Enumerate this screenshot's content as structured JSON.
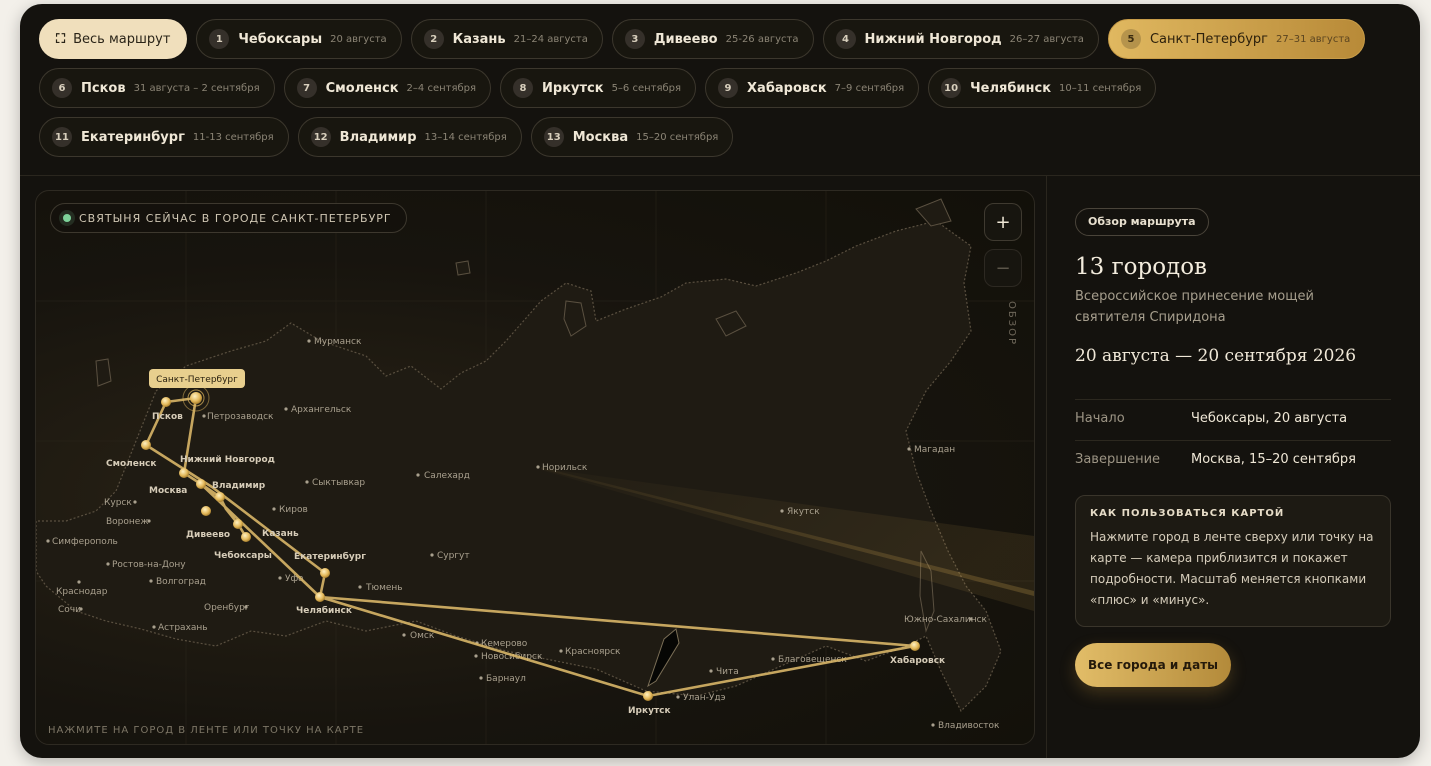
{
  "header": {
    "all_route_label": "Весь маршрут",
    "all_route_icon": "expand-icon",
    "stops": [
      {
        "num": "1",
        "city": "Чебоксары",
        "dates": "20 августа"
      },
      {
        "num": "2",
        "city": "Казань",
        "dates": "21–24 августа"
      },
      {
        "num": "3",
        "city": "Дивеево",
        "dates": "25-26 августа"
      },
      {
        "num": "4",
        "city": "Нижний Новгород",
        "dates": "26–27 августа"
      },
      {
        "num": "5",
        "city": "Санкт-Петербург",
        "dates": "27–31 августа",
        "active": true
      },
      {
        "num": "6",
        "city": "Псков",
        "dates": "31 августа – 2 сентября"
      },
      {
        "num": "7",
        "city": "Смоленск",
        "dates": "2–4 сентября"
      },
      {
        "num": "8",
        "city": "Иркутск",
        "dates": "5–6 сентября"
      },
      {
        "num": "9",
        "city": "Хабаровск",
        "dates": "7–9 сентября"
      },
      {
        "num": "10",
        "city": "Челябинск",
        "dates": "10–11 сентября"
      },
      {
        "num": "11",
        "city": "Екатеринбург",
        "dates": "11-13 сентября"
      },
      {
        "num": "12",
        "city": "Владимир",
        "dates": "13–14 сентября"
      },
      {
        "num": "13",
        "city": "Москва",
        "dates": "15–20 сентября"
      }
    ]
  },
  "map": {
    "badge": "СВЯТЫНЯ СЕЙЧАС В ГОРОДЕ САНКТ-ПЕТЕРБУРГ",
    "zoom_in": "+",
    "zoom_out": "−",
    "overview": "ОБЗОР",
    "hint": "НАЖМИТЕ НА ГОРОД В ЛЕНТЕ ИЛИ ТОЧКУ НА КАРТЕ",
    "active_tooltip": "Санкт-Петербург",
    "route_labels": {
      "spb": "Санкт-Петербург",
      "pskov": "Псков",
      "smolensk": "Смоленск",
      "nn": "Нижний Новгород",
      "moscow": "Москва",
      "vladimir": "Владимир",
      "diveevo": "Дивеево",
      "kazan": "Казань",
      "cheboksary": "Чебоксары",
      "ekb": "Екатеринбург",
      "chel": "Челябинск",
      "irkutsk": "Иркутск",
      "khab": "Хабаровск"
    },
    "other_cities": {
      "murmansk": "Мурманск",
      "petrozavodsk": "Петрозаводск",
      "arkhangelsk": "Архангельск",
      "syktyvkar": "Сыктывкар",
      "salekhard": "Салехард",
      "norilsk": "Норильск",
      "kirov": "Киров",
      "kursk": "Курск",
      "voronezh": "Воронеж",
      "simferopol": "Симферополь",
      "rostov": "Ростов-на-Дону",
      "volgograd": "Волгоград",
      "krasnodar": "Краснодар",
      "sochi": "Сочи",
      "orenburg": "Оренбург",
      "astrakhan": "Астрахань",
      "ufa": "Уфа",
      "tyumen": "Тюмень",
      "surgut": "Сургут",
      "omsk": "Омск",
      "kemerovo": "Кемерово",
      "novosibirsk": "Новосибирск",
      "barnaul": "Барнаул",
      "krasnoyarsk": "Красноярск",
      "chita": "Чита",
      "ulanude": "Улан-Удэ",
      "blagoveshchensk": "Благовещенск",
      "yakutsk": "Якутск",
      "magadan": "Магадан",
      "yuzhno": "Южно-Сахалинск",
      "vladivostok": "Владивосток"
    },
    "colors": {
      "route": "#d8b668",
      "accent": "#e0b860",
      "live": "#7ed39a"
    }
  },
  "panel": {
    "pill": "Обзор маршрута",
    "title": "13 городов",
    "subtitle": "Всероссийское принесение мощей святителя Спиридона",
    "dates": "20 августа — 20 сентября 2026",
    "start_label": "Начало",
    "start_value": "Чебоксары, 20 августа",
    "end_label": "Завершение",
    "end_value": "Москва, 15–20 сентября",
    "howto_title": "КАК ПОЛЬЗОВАТЬСЯ КАРТОЙ",
    "howto_body": "Нажмите город в ленте сверху или точку на карте — камера приблизится и покажет подробности. Масштаб меняется кнопками «плюс» и «минус».",
    "cta": "Все города и даты"
  }
}
